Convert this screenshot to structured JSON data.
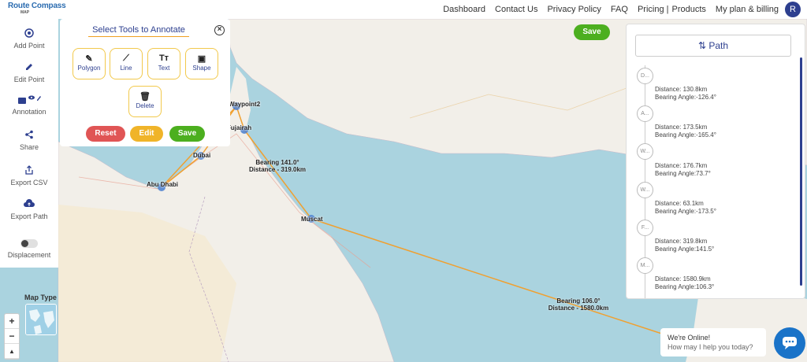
{
  "brand": {
    "name": "Route Compass",
    "sub": "MAP"
  },
  "nav": {
    "items": [
      "Dashboard",
      "Contact Us",
      "Privacy Policy",
      "FAQ",
      "Pricing |",
      "Products",
      "My plan & billing"
    ],
    "avatar": "R"
  },
  "sidebar": {
    "items": [
      {
        "label": "Add Point",
        "icon": "target-icon"
      },
      {
        "label": "Edit Point",
        "icon": "pencil-icon"
      },
      {
        "label": "Annotation",
        "icon": "annotation-icon"
      },
      {
        "label": "Share",
        "icon": "share-icon"
      },
      {
        "label": "Export CSV",
        "icon": "export-csv-icon"
      },
      {
        "label": "Export Path",
        "icon": "cloud-upload-icon"
      },
      {
        "label": "Displacement",
        "icon": "toggle-icon"
      }
    ]
  },
  "tools": {
    "title": "Select Tools to Annotate",
    "items": [
      {
        "label": "Polygon",
        "glyph": "✎"
      },
      {
        "label": "Line",
        "glyph": "⟋"
      },
      {
        "label": "Text",
        "glyph": "Tт"
      },
      {
        "label": "Shape",
        "glyph": "▣"
      },
      {
        "label": "Delete",
        "glyph": "🗑"
      }
    ],
    "reset_label": "Reset",
    "edit_label": "Edit",
    "save_label": "Save"
  },
  "save_top_label": "Save",
  "path_panel": {
    "title": "Path",
    "nodes": [
      "D...",
      "A...",
      "W...",
      "W...",
      "F...",
      "M..."
    ],
    "segments": [
      {
        "distance": "Distance: 130.8km",
        "bearing": "Bearing Angle:-126.4°"
      },
      {
        "distance": "Distance: 173.5km",
        "bearing": "Bearing Angle:-165.4°"
      },
      {
        "distance": "Distance: 176.7km",
        "bearing": "Bearing Angle:73.7°"
      },
      {
        "distance": "Distance: 63.1km",
        "bearing": "Bearing Angle:-173.5°"
      },
      {
        "distance": "Distance: 319.8km",
        "bearing": "Bearing Angle:141.5°"
      },
      {
        "distance": "Distance: 1580.9km",
        "bearing": "Bearing Angle:106.3°"
      }
    ]
  },
  "map": {
    "labels": [
      "Waypoint2",
      "Fujairah",
      "Dubai",
      "Abu Dhabi",
      "Muscat"
    ],
    "route_color": "#f0a030",
    "sea_color": "#aad3df",
    "land_color": "#f2efe9",
    "bearing_1": {
      "bearing": "Bearing  141.0°",
      "distance": "Distance - 319.0km"
    },
    "bearing_2": {
      "bearing": "Bearing  106.0°",
      "distance": "Distance - 1580.0km"
    }
  },
  "map_type_label": "Map Type",
  "zoom": {
    "in": "+",
    "out": "−",
    "reset": "▲"
  },
  "chat": {
    "line1": "We're Online!",
    "line2": "How may I help you today?"
  }
}
